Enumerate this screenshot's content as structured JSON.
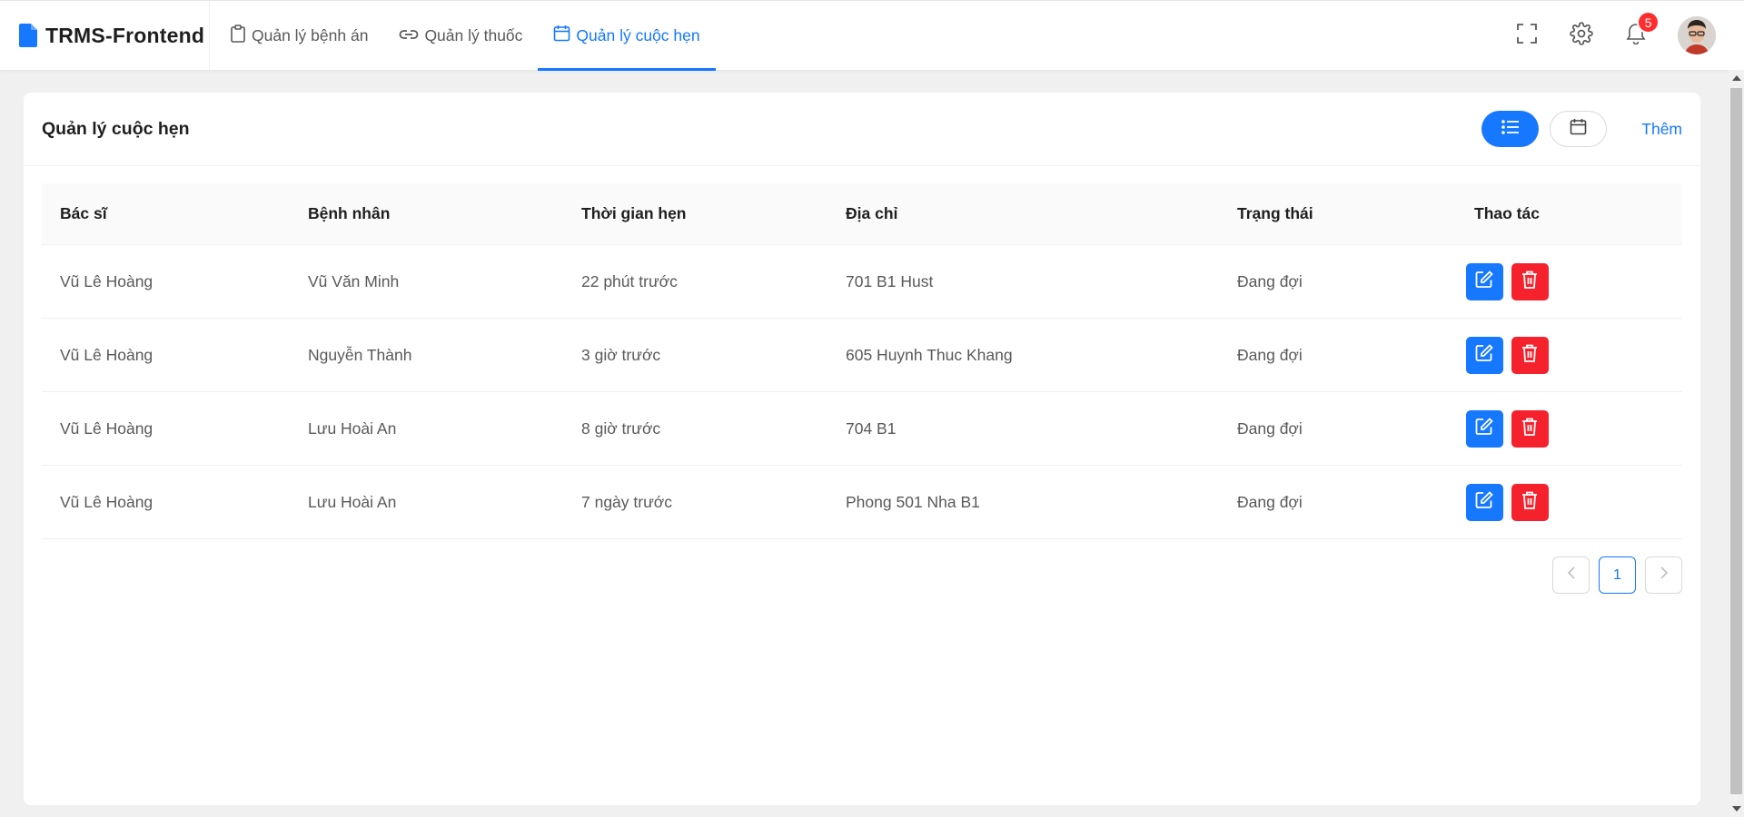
{
  "app": {
    "title": "TRMS-Frontend"
  },
  "nav": {
    "items": [
      {
        "label": "Quản lý bệnh án",
        "icon": "clipboard-icon"
      },
      {
        "label": "Quản lý thuốc",
        "icon": "link-icon"
      },
      {
        "label": "Quản lý cuộc hẹn",
        "icon": "calendar-icon",
        "active": true
      }
    ]
  },
  "header": {
    "notification_count": "5"
  },
  "card": {
    "title": "Quản lý cuộc hẹn",
    "add_label": "Thêm"
  },
  "table": {
    "columns": [
      "Bác sĩ",
      "Bệnh nhân",
      "Thời gian hẹn",
      "Địa chỉ",
      "Trạng thái",
      "Thao tác"
    ],
    "rows": [
      [
        "Vũ Lê Hoàng",
        "Vũ Văn Minh",
        "22 phút trước",
        "701 B1 Hust",
        "Đang đợi"
      ],
      [
        "Vũ Lê Hoàng",
        "Nguyễn Thành",
        "3 giờ trước",
        "605 Huynh Thuc Khang",
        "Đang đợi"
      ],
      [
        "Vũ Lê Hoàng",
        "Lưu Hoài An",
        "8 giờ trước",
        "704 B1",
        "Đang đợi"
      ],
      [
        "Vũ Lê Hoàng",
        "Lưu Hoài An",
        "7 ngày trước",
        "Phong 501 Nha B1",
        "Đang đợi"
      ]
    ]
  },
  "pagination": {
    "current_page": "1"
  },
  "colors": {
    "primary": "#1677ff",
    "danger": "#f5222d",
    "badge": "#ff2d2d"
  }
}
